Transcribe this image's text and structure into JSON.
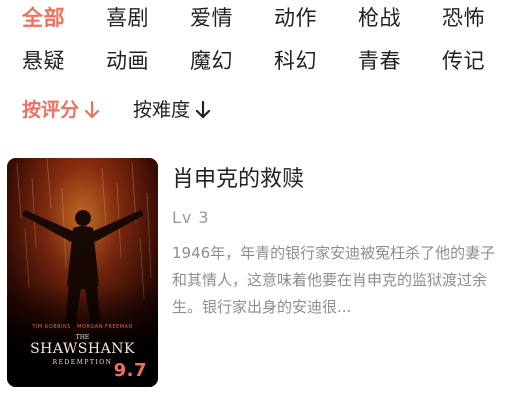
{
  "genres": {
    "row1": [
      "全部",
      "喜剧",
      "爱情",
      "动作",
      "枪战",
      "恐怖"
    ],
    "row2": [
      "悬疑",
      "动画",
      "魔幻",
      "科幻",
      "青春",
      "传记"
    ],
    "active": "全部"
  },
  "sort": {
    "by_rating": "按评分",
    "by_difficulty": "按难度"
  },
  "movie": {
    "title": "肖申克的救赎",
    "level_prefix": "Lv",
    "level": "3",
    "description": "1946年，年青的银行家安迪被冤枉杀了他的妻子和其情人，这意味着他要在肖申克的监狱渡过余生。银行家出身的安迪很...",
    "rating": "9.7",
    "poster": {
      "title_small": "THE",
      "title_main": "SHAWSHANK",
      "subtitle": "REDEMPTION",
      "credits": "TIM ROBBINS · MORGAN FREEMAN"
    }
  },
  "colors": {
    "accent": "#f0705e",
    "text": "#222222",
    "muted": "#999999",
    "description": "#8e8e8e"
  },
  "icons": {
    "sort_active": "arrow-down-icon",
    "sort_inactive": "arrow-down-icon"
  }
}
